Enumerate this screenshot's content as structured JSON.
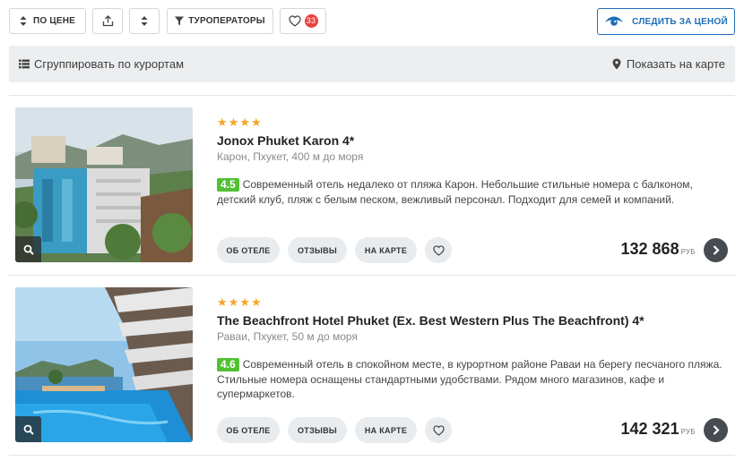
{
  "toolbar": {
    "sort_label": "ПО ЦЕНЕ",
    "touroperators_label": "ТУРОПЕРАТОРЫ",
    "favorites_count": "33",
    "watch_price_label": "СЛЕДИТЬ ЗА ЦЕНОЙ"
  },
  "group_bar": {
    "group_label": "Сгруппировать по курортам",
    "map_label": "Показать на карте"
  },
  "hotels": [
    {
      "stars": 4,
      "name": "Jonox Phuket Karon 4*",
      "location": "Карон, Пхукет, 400 м до моря",
      "rating": "4.5",
      "description": "Современный отель недалеко от пляжа Карон. Небольшие стильные номера с балконом, детский клуб, пляж с белым песком, вежливый персонал. Подходит для семей и компаний.",
      "btn_about": "ОБ ОТЕЛЕ",
      "btn_reviews": "ОТЗЫВЫ",
      "btn_map": "НА КАРТЕ",
      "price": "132 868",
      "currency": "РУБ"
    },
    {
      "stars": 4,
      "name": "The Beachfront Hotel Phuket (Ex. Best Western Plus The Beachfront) 4*",
      "location": "Раваи, Пхукет, 50 м до моря",
      "rating": "4.6",
      "description": "Современный отель в спокойном месте, в курортном районе Раваи на берегу песчаного пляжа. Стильные номера оснащены стандартными удобствами. Рядом много магазинов, кафе и супермаркетов.",
      "btn_about": "ОБ ОТЕЛЕ",
      "btn_reviews": "ОТЗЫВЫ",
      "btn_map": "НА КАРТЕ",
      "price": "142 321",
      "currency": "РУБ"
    }
  ],
  "colors": {
    "accent_blue": "#1f6fb8",
    "star": "#f5a623",
    "rating_green": "#52c033",
    "badge_red": "#e8423f"
  },
  "icons": {
    "sort": "sort-updown-icon",
    "share": "share-icon",
    "updown": "updown-icon",
    "filter": "filter-funnel-icon",
    "favorite": "heart-icon",
    "watch": "eye-icon",
    "group": "list-icon",
    "map": "map-pin-icon",
    "zoom": "magnifier-icon",
    "next": "chevron-right-icon"
  }
}
